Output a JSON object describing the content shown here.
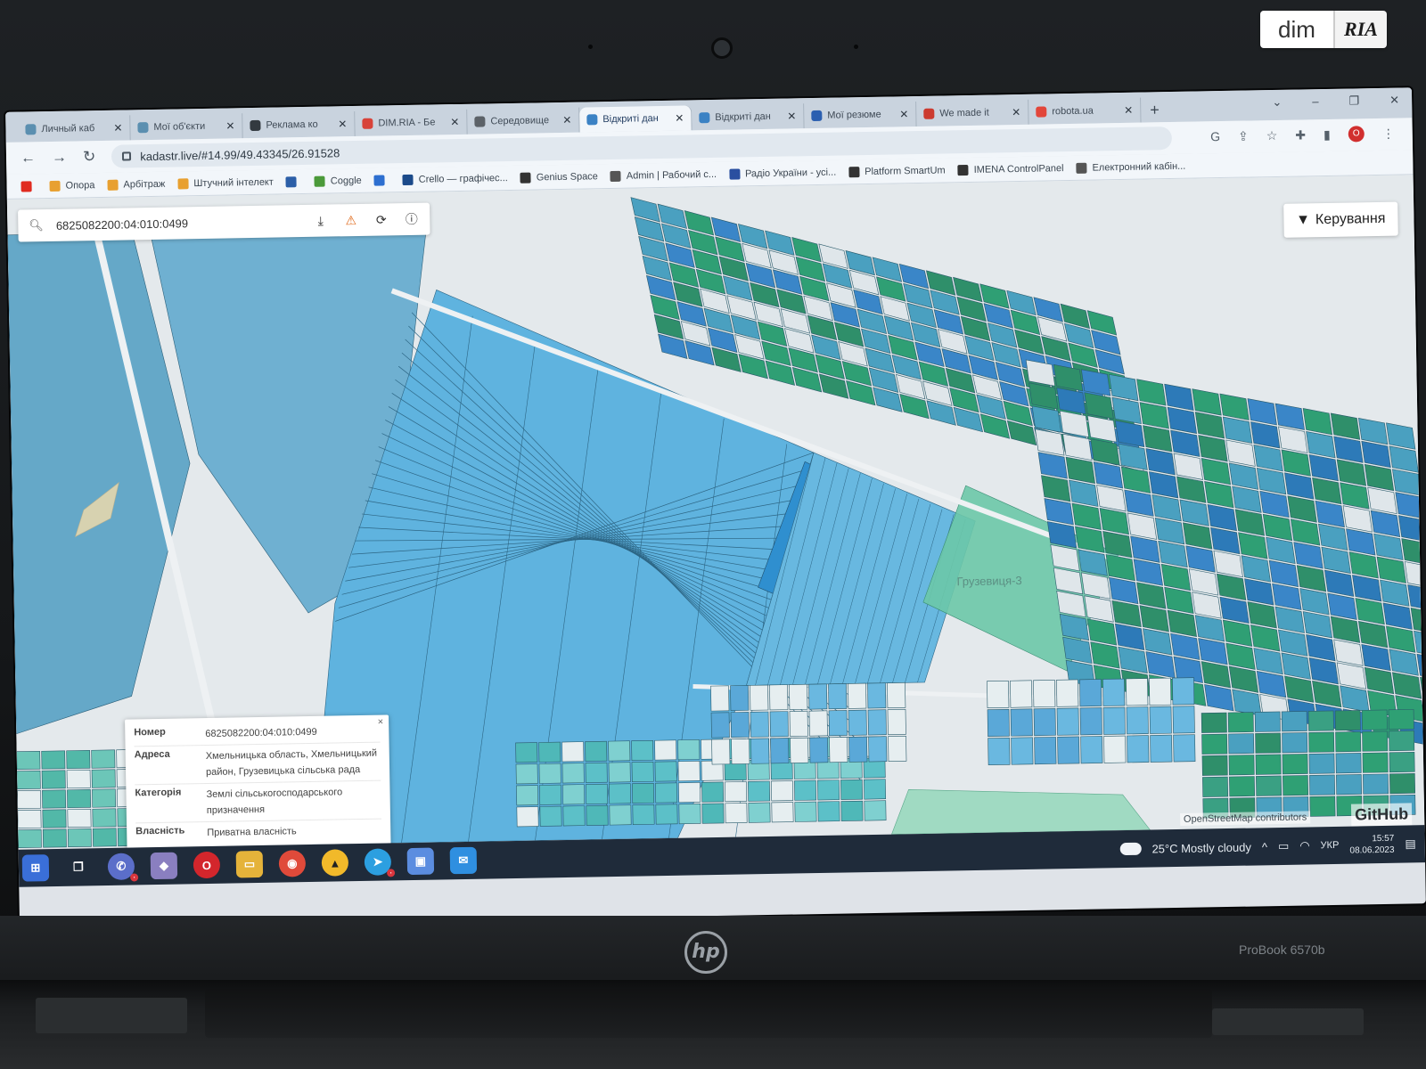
{
  "watermark": {
    "dim": "dim",
    "ria": "RIA"
  },
  "laptop": {
    "brand": "hp",
    "model": "ProBook 6570b"
  },
  "browser": {
    "tabs": [
      {
        "label": "Личный каб",
        "icon_color": "#5b8fb0",
        "active": false
      },
      {
        "label": "Мої об'єкти",
        "icon_color": "#5b8fb0",
        "active": false
      },
      {
        "label": "Реклама ко",
        "icon_color": "#333a40",
        "active": false
      },
      {
        "label": "DIM.RIA - Бе",
        "icon_color": "#d8433a",
        "active": false
      },
      {
        "label": "Середовище",
        "icon_color": "#5c6268",
        "active": false
      },
      {
        "label": "Відкриті дан",
        "icon_color": "#3b82c4",
        "active": true
      },
      {
        "label": "Відкриті дан",
        "icon_color": "#3b82c4",
        "active": false
      },
      {
        "label": "Мої резюме",
        "icon_color": "#2b5fb0",
        "active": false
      },
      {
        "label": "We made it",
        "icon_color": "#cc3b2f",
        "active": false
      },
      {
        "label": "robota.ua",
        "icon_color": "#e2463a",
        "active": false
      }
    ],
    "new_tab_label": "+",
    "url": "kadastr.live/#14.99/49.43345/26.91528",
    "bookmarks": [
      {
        "label": "",
        "icon_color": "#e02b20"
      },
      {
        "label": "Опора",
        "icon_color": "#e8a030"
      },
      {
        "label": "Арбітраж",
        "icon_color": "#e8a030"
      },
      {
        "label": "Штучний інтелект",
        "icon_color": "#e8a030"
      },
      {
        "label": "",
        "icon_color": "#2c5fa8"
      },
      {
        "label": "Coggle",
        "icon_color": "#4b9a3a"
      },
      {
        "label": "",
        "icon_color": "#2d6fd0"
      },
      {
        "label": "Crello — графічес...",
        "icon_color": "#1b4a8a"
      },
      {
        "label": "Genius Space",
        "icon_color": "#333333"
      },
      {
        "label": "Admin | Рабочий с...",
        "icon_color": "#555555"
      },
      {
        "label": "Радіо України - усі...",
        "icon_color": "#2a4fa0"
      },
      {
        "label": "Platform SmartUm",
        "icon_color": "#333333"
      },
      {
        "label": "IMENA ControlPanel",
        "icon_color": "#333333"
      },
      {
        "label": "Електронний кабін...",
        "icon_color": "#555555"
      }
    ]
  },
  "map": {
    "search_value": "6825082200:04:010:0499",
    "manage_label": "Керування",
    "place_label": "Грузевиця-3",
    "attribution": "OpenStreetMap contributors",
    "github_label": "GitHub",
    "popup": {
      "rows": [
        {
          "key": "Номер",
          "value": "6825082200:04:010:0499"
        },
        {
          "key": "Адреса",
          "value": "Хмельницька область, Хмельницький район, Грузевицька сільська рада"
        },
        {
          "key": "Категорія",
          "value": "Землі сільськогосподарського призначення"
        },
        {
          "key": "Власність",
          "value": "Приватна власність"
        }
      ]
    },
    "colors": {
      "parcel_blue": "#4fa3d8",
      "parcel_green": "#3aa87a",
      "parcel_teal": "#3ab0b8",
      "road": "#eef1f3"
    }
  },
  "taskbar": {
    "weather": "25°C  Mostly cloudy",
    "language": "УКР",
    "time": "15:57",
    "date": "08.06.2023"
  }
}
